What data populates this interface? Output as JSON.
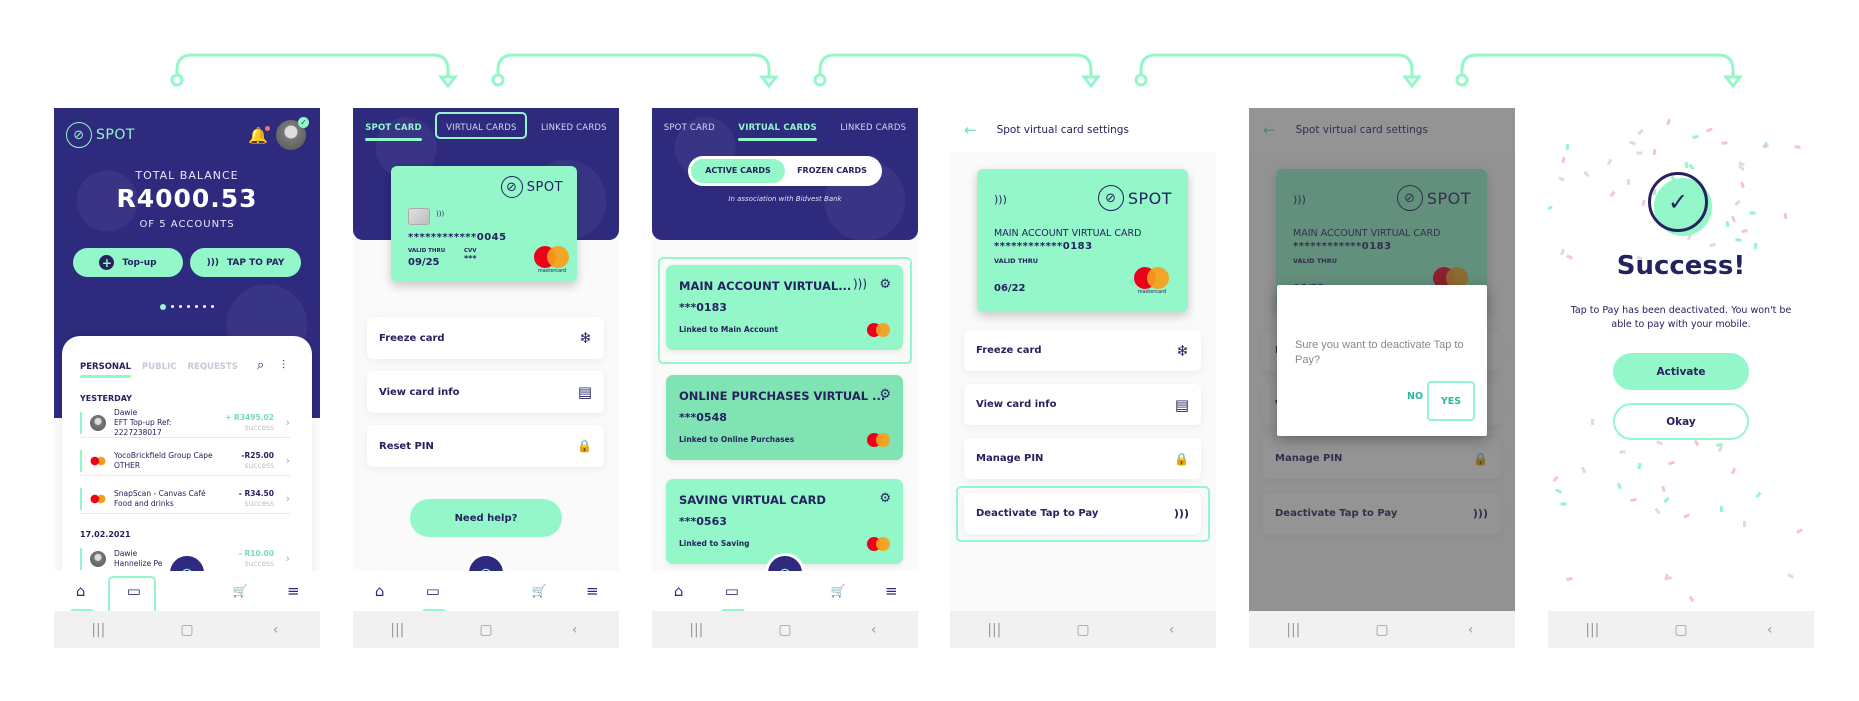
{
  "colors": {
    "brand_navy": "#2e2a7d",
    "brand_mint": "#93f7c9",
    "text_dark": "#25225e",
    "mastercard_red": "#eb001b",
    "mastercard_orange": "#f79e1b"
  },
  "icons": {
    "logo": "⊘",
    "bell": "🔔",
    "plus": "+",
    "nfc": ")))",
    "search": "⌕",
    "filter": "⫶",
    "chevron_right": "›",
    "home": "⌂",
    "cards": "▭",
    "cart": "🛒",
    "menu": "≡",
    "sys_recent": "|||",
    "sys_home": "▢",
    "sys_back": "‹",
    "snowflake": "❄",
    "card_info": "▤",
    "lock": "🔒",
    "gear": "⚙",
    "back_arrow": "←",
    "check": "✓"
  },
  "common": {
    "brand_name": "SPOT",
    "nav": [
      "home",
      "cards",
      "cart",
      "menu"
    ],
    "tabs": [
      "SPOT CARD",
      "VIRTUAL CARDS",
      "LINKED CARDS"
    ],
    "mastercard": "mastercard"
  },
  "screen1": {
    "balance_label": "TOTAL BALANCE",
    "balance_value": "R4000.53",
    "balance_sub": "OF 5 ACCOUNTS",
    "topup_label": "Top-up",
    "tap_to_pay_label": "TAP TO PAY",
    "carousel": {
      "count": 7,
      "active": 1
    },
    "tabs": [
      "PERSONAL",
      "PUBLIC",
      "REQUESTS"
    ],
    "groups": [
      {
        "label": "YESTERDAY",
        "items": [
          {
            "icon": "person",
            "name": "Dawie",
            "detail": "EFT Top-up Ref: 2227238017",
            "amount": "+ R3495.02",
            "status": "success",
            "positive": true
          },
          {
            "icon": "mc",
            "name": "YocoBrickfield Group  Cape",
            "detail": "OTHER",
            "amount": "-R25.00",
            "status": "success",
            "positive": false
          },
          {
            "icon": "mc",
            "name": "SnapScan - Canvas Café",
            "detail": "Food and drinks",
            "amount": "- R34.50",
            "status": "success",
            "positive": false
          }
        ]
      },
      {
        "label": "17.02.2021",
        "items": [
          {
            "icon": "person",
            "name": "Dawie",
            "detail": "Hannelize Pe",
            "amount": "- R10.00",
            "status": "success",
            "positive": true
          }
        ]
      }
    ]
  },
  "screen2": {
    "active_tab": 0,
    "highlighted_tab": 1,
    "card": {
      "pan": "************0045",
      "valid_label": "VALID THRU",
      "valid": "09/25",
      "cvv_label": "CVV",
      "cvv": "***"
    },
    "options": [
      "Freeze card",
      "View card info",
      "Reset PIN"
    ],
    "help_label": "Need help?"
  },
  "screen3": {
    "active_tab": 1,
    "segments": [
      "ACTIVE CARDS",
      "FROZEN CARDS"
    ],
    "active_segment": 0,
    "association": "In association with Bidvest Bank",
    "cards": [
      {
        "title": "MAIN ACCOUNT VIRTUAL...",
        "number": "***0183",
        "linked": "Linked to Main Account",
        "nfc": true
      },
      {
        "title": "ONLINE PURCHASES VIRTUAL ...",
        "number": "***0548",
        "linked": "Linked to Online Purchases",
        "nfc": false
      },
      {
        "title": "SAVING VIRTUAL CARD",
        "number": "***0563",
        "linked": "Linked to Saving",
        "nfc": false
      }
    ]
  },
  "screen4": {
    "title": "Spot virtual card settings",
    "card": {
      "name": "MAIN ACCOUNT VIRTUAL CARD",
      "pan": "************0183",
      "valid_label": "VALID THRU",
      "valid": "06/22"
    },
    "options": [
      "Freeze card",
      "View card info",
      "Manage PIN",
      "Deactivate Tap to Pay"
    ]
  },
  "screen5": {
    "dialog_message": "Sure you want to deactivate Tap to Pay?",
    "no_label": "NO",
    "yes_label": "YES"
  },
  "screen6": {
    "title": "Success!",
    "message": "Tap to Pay has been deactivated. You won't be able to pay with your mobile.",
    "activate_label": "Activate",
    "okay_label": "Okay"
  }
}
